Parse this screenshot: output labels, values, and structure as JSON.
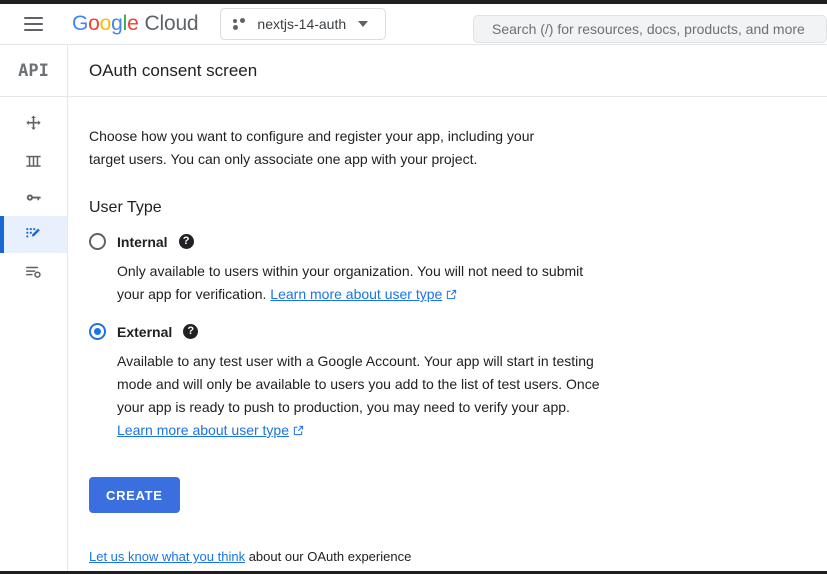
{
  "header": {
    "menu_icon": "hamburger-menu-icon",
    "brand": {
      "g1": "G",
      "o1": "o",
      "o2": "o",
      "g2": "g",
      "l1": "l",
      "e1": "e",
      "cloud": "Cloud"
    },
    "project_selector": {
      "icon": "project-dots-icon",
      "name": "nextjs-14-auth",
      "caret": "chevron-down-icon"
    },
    "search": {
      "icon": "search-icon",
      "placeholder": "Search (/) for resources, docs, products, and more",
      "value": ""
    }
  },
  "rail": {
    "logo": "API",
    "items": [
      {
        "name": "sidebar-item-enabled-apis",
        "icon": "move-arrows-icon"
      },
      {
        "name": "sidebar-item-library",
        "icon": "library-columns-icon"
      },
      {
        "name": "sidebar-item-credentials",
        "icon": "key-icon"
      },
      {
        "name": "sidebar-item-oauth-consent-screen",
        "icon": "edit-pencil-icon",
        "active": true
      },
      {
        "name": "sidebar-item-page-usage-agreement",
        "icon": "list-settings-icon"
      }
    ]
  },
  "main": {
    "title": "OAuth consent screen",
    "intro": "Choose how you want to configure and register your app, including your target users. You can only associate one app with your project.",
    "section_title": "User Type",
    "options": [
      {
        "id": "internal",
        "label": "Internal",
        "selected": false,
        "help_icon": "help-circle-icon",
        "description_before": "Only available to users within your organization. You will not need to submit your app for verification. ",
        "link_text": "Learn more about user type",
        "link_icon": "external-link-icon",
        "description_after": ""
      },
      {
        "id": "external",
        "label": "External",
        "selected": true,
        "help_icon": "help-circle-icon",
        "description_before": "Available to any test user with a Google Account. Your app will start in testing mode and will only be available to users you add to the list of test users. Once your app is ready to push to production, you may need to verify your app. ",
        "link_text": "Learn more about user type",
        "link_icon": "external-link-icon",
        "description_after": ""
      }
    ],
    "create_button": "CREATE",
    "footer": {
      "link_text": "Let us know what you think",
      "rest_text": " about our OAuth experience"
    }
  },
  "colors": {
    "accent_blue": "#1a73e8",
    "button_blue": "#3b6fe0",
    "active_rail_bg": "#e8f0fe",
    "active_rail_bar": "#1967d2",
    "search_bg": "#f1f3f4",
    "text_primary": "#202124",
    "border": "#e4e6e8"
  }
}
